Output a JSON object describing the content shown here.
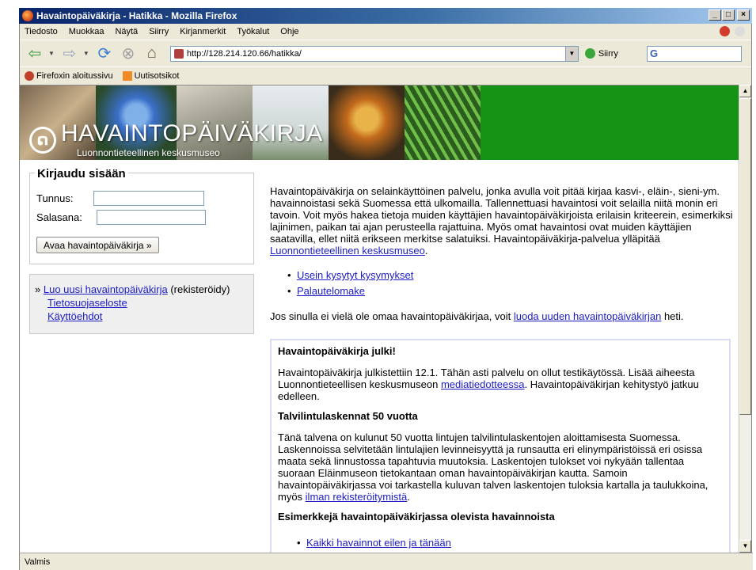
{
  "window": {
    "title": "Havaintopäiväkirja - Hatikka - Mozilla Firefox"
  },
  "menu": [
    "Tiedosto",
    "Muokkaa",
    "Näytä",
    "Siirry",
    "Kirjanmerkit",
    "Työkalut",
    "Ohje"
  ],
  "navbar": {
    "url": "http://128.214.120.66/hatikka/",
    "go_label": "Siirry",
    "search_glyph": "G"
  },
  "bookmarks": [
    "Firefoxin aloitussivu",
    "Uutisotsikot"
  ],
  "banner": {
    "title": "HAVAINTOPÄIVÄKIRJA",
    "subtitle": "Luonnontieteellinen keskusmuseo"
  },
  "login": {
    "heading": "Kirjaudu sisään",
    "username_label": "Tunnus:",
    "password_label": "Salasana:",
    "submit_label": "Avaa havaintopäiväkirja »"
  },
  "sidebar_links": {
    "prefix": "»",
    "create_link": "Luo uusi havaintopäiväkirja",
    "create_note": "(rekisteröidy)",
    "privacy_link": "Tietosuojaseloste",
    "terms_link": "Käyttöehdot"
  },
  "main": {
    "intro_text": "Havaintopäiväkirja on selainkäyttöinen palvelu, jonka avulla voit pitää kirjaa kasvi-, eläin-, sieni-ym. havainnoistasi sekä Suomessa että ulkomailla. Tallennettuasi havaintosi voit selailla niitä monin eri tavoin. Voit myös hakea tietoja muiden käyttäjien havaintopäiväkirjoista erilaisin kriteerein, esimerkiksi lajinimen, paikan tai ajan perusteella rajattuina. Myös omat havaintosi ovat muiden käyttäjien saatavilla, ellet niitä erikseen merkitse salatuiksi. Havaintopäiväkirja-palvelua ylläpitää ",
    "intro_link": "Luonnontieteellinen keskusmuseo",
    "intro_end": ".",
    "links": [
      "Usein kysytyt kysymykset",
      "Palautelomake"
    ],
    "signup_text": "Jos sinulla ei vielä ole omaa havaintopäiväkirjaa, voit ",
    "signup_link": "luoda uuden havaintopäiväkirjan",
    "signup_end": " heti."
  },
  "news": {
    "h1": "Havaintopäiväkirja julki!",
    "p1_text": "Havaintopäiväkirja julkistettiin 12.1. Tähän asti palvelu on ollut testikäytössä. Lisää aiheesta Luonnontieteellisen keskusmuseon ",
    "p1_link": "mediatiedotteessa",
    "p1_end": ". Havaintopäiväkirjan kehitystyö jatkuu edelleen.",
    "h2": "Talvilintulaskennat 50 vuotta",
    "p2_text": "Tänä talvena on kulunut 50 vuotta lintujen talvilintulaskentojen aloittamisesta Suomessa. Laskennoissa selvitetään lintulajien levinneisyyttä ja runsautta eri elinympäristöissä eri osissa maata sekä linnustossa tapahtuvia muutoksia. Laskentojen tulokset voi nykyään tallentaa suoraan Eläinmuseon tietokantaan oman havaintopäiväkirjan kautta. Samoin havaintopäiväkirjassa voi tarkastella kuluvan talven laskentojen tuloksia kartalla ja taulukkoina, myös ",
    "p2_link": "ilman rekisteröitymistä",
    "p2_end": ".",
    "h3": "Esimerkkejä havaintopäiväkirjassa olevista havainnoista",
    "examples": [
      "Kaikki havainnot eilen ja tänään"
    ]
  },
  "status": "Valmis"
}
